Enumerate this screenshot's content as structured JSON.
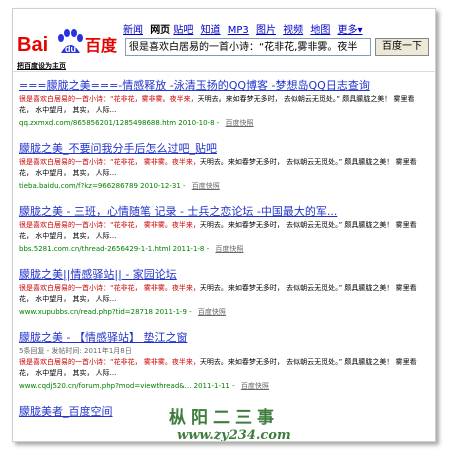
{
  "nav": {
    "items": [
      "新闻",
      "网页",
      "贴吧",
      "知道",
      "MP3",
      "图片",
      "视频",
      "地图",
      "更多▾"
    ],
    "current": "网页"
  },
  "logo": {
    "text_left": "Bai",
    "text_paw": "du",
    "text_right": "百度"
  },
  "search": {
    "query": "很是喜欢白居易的一首小诗：“花非花,雾非雾。夜半",
    "button_label": "百度一下"
  },
  "sethome_label": "把百度设为主页",
  "results": [
    {
      "title": "===朦胧之美===-情感释放 -泳清玉扬的QQ博客 -梦想岛QQ日志查询",
      "meta": "",
      "snippet_red": "很是喜欢白居易的一首小诗：“花非花，雾非雾。夜半来，",
      "snippet_rest": "天明去。来如春梦无多时， 去似朝云无觅处。”  颇具朦胧之美！  雾里看花， 水中望月， 其实， 人际...",
      "url": "qq.zxmxd.com/865856201/1285498688.htm 2010-10-8",
      "cache": "百度快照"
    },
    {
      "title": "朦胧之美_不要问我分手后怎么过吧_贴吧",
      "meta": "",
      "snippet_red": "很是喜欢白居易的一首小诗：“花非花， 雾非雾。夜半来，",
      "snippet_rest": "天明去。来如春梦无多时， 去似朝云无觅处。”  颇具朦胧之美！  雾里看花， 水中望月， 其实， 人际...",
      "url": "tieba.baidu.com/f?kz=966286789 2010-12-31",
      "cache": "百度快照"
    },
    {
      "title": "朦胧之美 - 三班，心情随笔 记录 - 士兵之恋论坛 -中国最大的军...",
      "meta": "",
      "snippet_red": "很是喜欢白居易的一首小诗：“花非花， 雾非雾。夜半来，",
      "snippet_rest": "天明去。来如春梦无多时， 去似朝云无觅处。”  颇具朦胧之美！  雾里看花， 水中望月， 其实， 人际...",
      "url": "bbs.5281.com.cn/thread-2656429-1-1.html 2011-1-8",
      "cache": "百度快照"
    },
    {
      "title": "朦胧之美||情感驿站|| - 家园论坛",
      "meta": "",
      "snippet_red": "很是喜欢白居易的一首小诗：“花非花， 雾非雾。夜半来，",
      "snippet_rest": "天明去。来如春梦无多时， 去似朝云无觅处。”  颇具朦胧之美！  雾里看花， 水中望月， 其实， 人际...",
      "url": "www.xupubbs.cn/read.php?tid=28718 2011-1-9",
      "cache": "百度快照"
    },
    {
      "title": "朦胧之美 - 【情感驿站】 垫江之窗",
      "meta": "5条回复 - 发帖时间: 2011年1月8日",
      "snippet_red": "很是喜欢白居易的一首小诗：“花非花， 雾非雾。夜半来，",
      "snippet_rest": "天明去。来如春梦无多时， 去似朝云无觅处。”  颇具朦胧之美！  雾里看花， 水中望月， 其实， 人际...",
      "url": "www.cqdj520.cn/forum.php?mod=viewthread&... 2011-1-11",
      "cache": "百度快照"
    },
    {
      "title": "朦胧美者_百度空间",
      "meta": "",
      "snippet_red": "",
      "snippet_rest": "",
      "url": "",
      "cache": ""
    }
  ],
  "watermark": {
    "top": "枞阳二三事",
    "bottom": "www.zy234.com"
  },
  "colors": {
    "link": "#2233cc",
    "highlight": "#cc0000",
    "url": "#008000",
    "watermark": "#3f7d3f"
  }
}
